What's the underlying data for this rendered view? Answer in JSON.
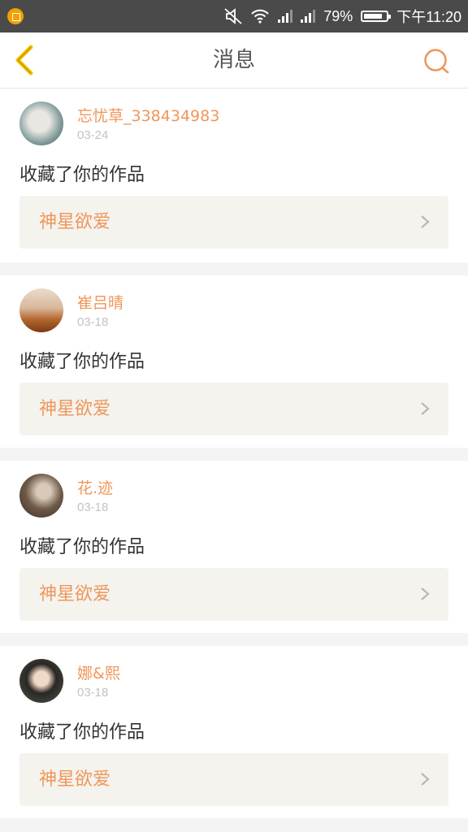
{
  "status": {
    "battery": "79%",
    "time": "下午11:20",
    "icons": [
      "app-notification-icon",
      "mute-icon",
      "wifi-icon",
      "signal-icon",
      "signal-icon",
      "battery-icon"
    ]
  },
  "header": {
    "title": "消息",
    "back_icon": "chevron-left-icon",
    "search_icon": "search-icon",
    "accent": "#f0965a",
    "back_color": "#f5c400"
  },
  "messages": [
    {
      "user": "忘忧草_338434983",
      "date": "03-24",
      "action": "收藏了你的作品",
      "work": "神星欲爱"
    },
    {
      "user": "崔吕晴",
      "date": "03-18",
      "action": "收藏了你的作品",
      "work": "神星欲爱"
    },
    {
      "user": "花.迹",
      "date": "03-18",
      "action": "收藏了你的作品",
      "work": "神星欲爱"
    },
    {
      "user": "娜&熙",
      "date": "03-18",
      "action": "收藏了你的作品",
      "work": "神星欲爱"
    }
  ]
}
